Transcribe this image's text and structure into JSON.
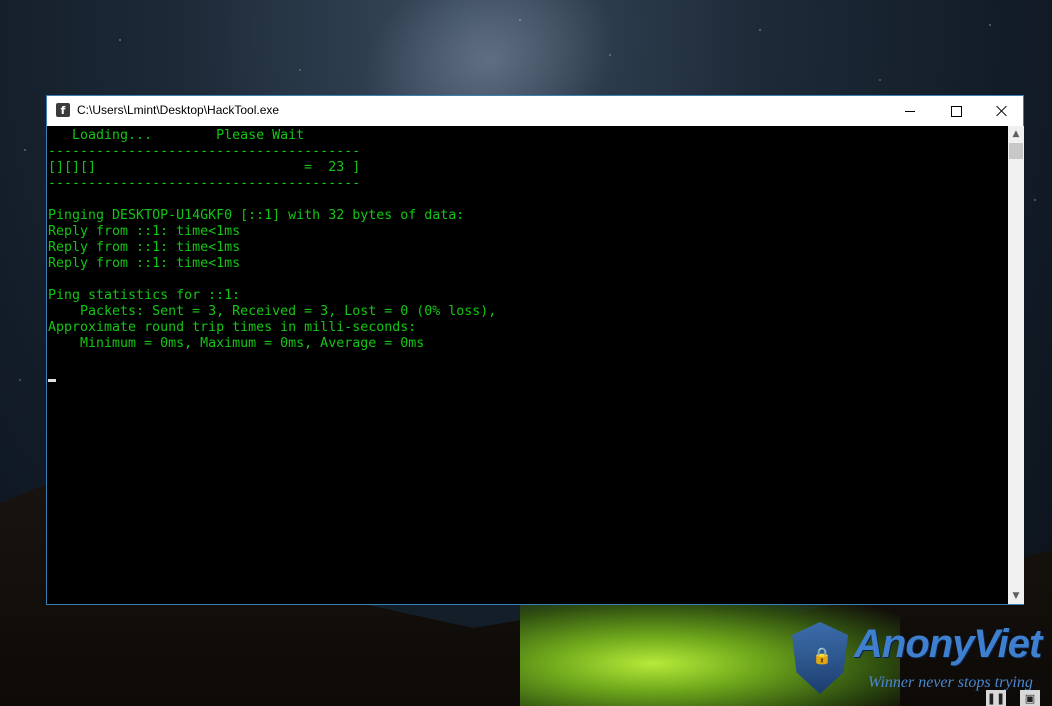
{
  "window": {
    "title": "C:\\Users\\Lmint\\Desktop\\HackTool.exe",
    "app_icon_glyph": "f",
    "minimize_icon": "minimize-icon",
    "maximize_icon": "maximize-icon",
    "close_icon": "close-icon"
  },
  "console": {
    "text_color": "#13c513",
    "background": "#000000",
    "lines": [
      "   Loading...        Please Wait",
      "---------------------------------------",
      "[][][]                          =  23 ]",
      "---------------------------------------",
      "",
      "Pinging DESKTOP-U14GKF0 [::1] with 32 bytes of data:",
      "Reply from ::1: time<1ms",
      "Reply from ::1: time<1ms",
      "Reply from ::1: time<1ms",
      "",
      "Ping statistics for ::1:",
      "    Packets: Sent = 3, Received = 3, Lost = 0 (0% loss),",
      "Approximate round trip times in milli-seconds:",
      "    Minimum = 0ms, Maximum = 0ms, Average = 0ms",
      ""
    ]
  },
  "scrollbar": {
    "up_arrow": "▲",
    "down_arrow": "▼"
  },
  "watermark": {
    "brand": "AnonyViet",
    "tagline": "Winner never stops trying"
  },
  "media_controls": {
    "pause_glyph": "❚❚",
    "screen_glyph": "▣"
  }
}
